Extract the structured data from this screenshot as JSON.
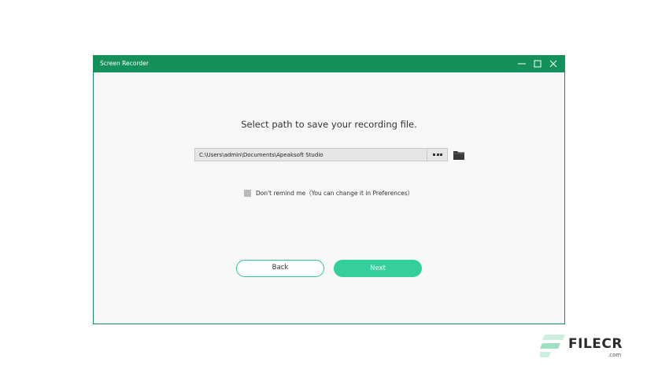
{
  "window": {
    "title": "Screen Recorder",
    "controls": [
      "minimize-icon",
      "maximize-icon",
      "close-icon"
    ]
  },
  "main": {
    "heading": "Select path to save your recording file.",
    "path_value": "C:\\Users\\admin\\Documents\\Apeaksoft Studio",
    "browse_icon": "more-dots-icon",
    "folder_icon": "folder-icon",
    "remind_label": "Don't remind me（You can change it in Preferences）",
    "remind_checked": false
  },
  "buttons": {
    "back_label": "Back",
    "next_label": "Next"
  },
  "watermark": {
    "name": "FILECR",
    "suffix": ".com"
  },
  "colors": {
    "titlebar": "#14915b",
    "accent": "#35d09a",
    "window_bg": "#f7f7f7"
  }
}
